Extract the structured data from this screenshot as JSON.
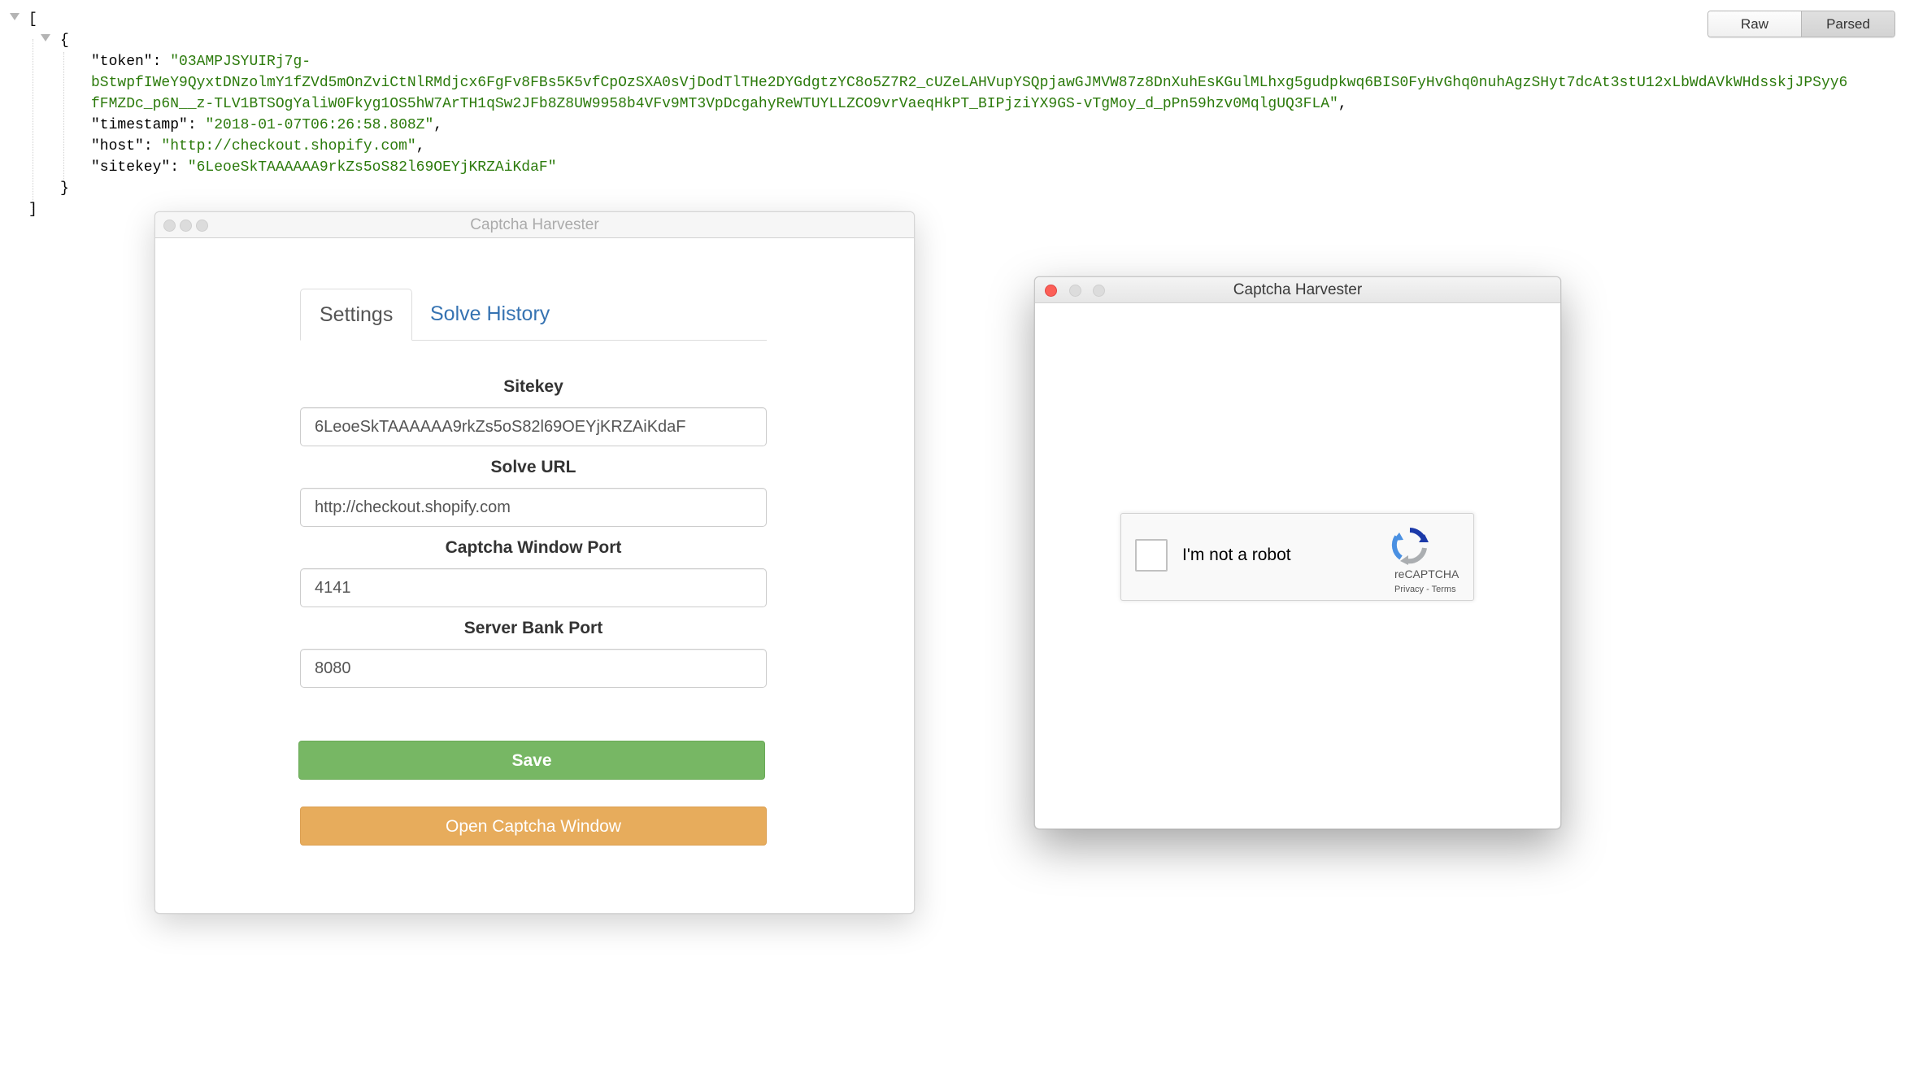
{
  "json_viewer": {
    "open_bracket": "[",
    "close_bracket": "]",
    "open_brace": "{",
    "close_brace": "}",
    "token_key": "\"token\"",
    "token_line1": "\"03AMPJSYUIRj7g-",
    "token_line2": "bStwpfIWeY9QyxtDNzolmY1fZVd5mOnZviCtNlRMdjcx6FgFv8FBs5K5vfCpOzSXA0sVjDodTlTHe2DYGdgtzYC8o5Z7R2_cUZeLAHVupYSQpjawGJMVW87z8DnXuhEsKGulMLhxg5gudpkwq6BIS0FyHvGhq0nuhAgzSHyt7dcAt3stU12xLbWdAVkWHdsskjJPSyy6",
    "token_line3": "fFMZDc_p6N__z-TLV1BTSOgYaliW0Fkyg1OS5hW7ArTH1qSw2JFb8Z8UW9958b4VFv9MT3VpDcgahyReWTUYLLZCO9vrVaeqHkPT_BIPjziYX9GS-vTgMoy_d_pPn59hzv0MqlgUQ3FLA\"",
    "timestamp_key": "\"timestamp\"",
    "timestamp_value": "\"2018-01-07T06:26:58.808Z\"",
    "host_key": "\"host\"",
    "host_value": "\"http://checkout.shopify.com\"",
    "sitekey_key": "\"sitekey\"",
    "sitekey_value": "\"6LeoeSkTAAAAAA9rkZs5oS82l69OEYjKRZAiKdaF\"",
    "colon": ": ",
    "comma": ","
  },
  "view_toggle": {
    "raw_label": "Raw",
    "parsed_label": "Parsed",
    "active": "Parsed"
  },
  "settings_window": {
    "title": "Captcha Harvester",
    "tabs": [
      {
        "label": "Settings",
        "active": true
      },
      {
        "label": "Solve History",
        "active": false
      }
    ],
    "fields": {
      "sitekey_label": "Sitekey",
      "sitekey_value": "6LeoeSkTAAAAAA9rkZs5oS82l69OEYjKRZAiKdaF",
      "solve_url_label": "Solve URL",
      "solve_url_value": "http://checkout.shopify.com",
      "captcha_port_label": "Captcha Window Port",
      "captcha_port_value": "4141",
      "server_port_label": "Server Bank Port",
      "server_port_value": "8080"
    },
    "save_label": "Save",
    "open_captcha_label": "Open Captcha Window"
  },
  "captcha_window": {
    "title": "Captcha Harvester",
    "recaptcha": {
      "checkbox_label": "I'm not a robot",
      "brand": "reCAPTCHA",
      "privacy": "Privacy",
      "separator": " - ",
      "terms": "Terms"
    }
  },
  "colors": {
    "json_string": "#2b7a0b",
    "link_blue": "#3673b2",
    "save_green": "#77b764",
    "open_orange": "#e7ac5c",
    "close_red": "#fc5f57",
    "minimize_yellow": "#dddddd",
    "zoom_green": "#dddddd"
  }
}
